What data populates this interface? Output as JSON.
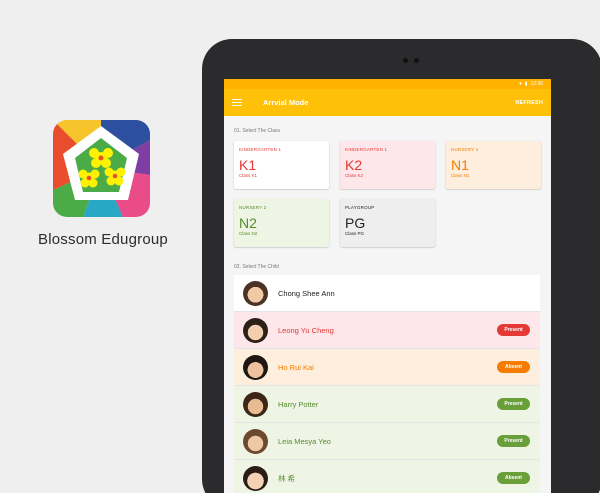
{
  "brand": {
    "name": "Blossom Edugroup",
    "logo_colors": [
      "#f7c42b",
      "#e84e2d",
      "#ea4c89",
      "#7e3ea3",
      "#2c4fa0",
      "#29a8c6",
      "#4bab47",
      "#fff200"
    ]
  },
  "status_bar": {
    "time": "12:30"
  },
  "app_bar": {
    "title": "Arrvial Mode",
    "refresh_label": "REFRESH",
    "accent": "#ffc107"
  },
  "section_class": {
    "title": "01.  Select The Class"
  },
  "classes": [
    {
      "category": "KINDERGARTEN 1",
      "code": "K1",
      "subtitle": "Class K1"
    },
    {
      "category": "KINDERGARTEN 1",
      "code": "K2",
      "subtitle": "Class K2"
    },
    {
      "category": "NURSERY 1",
      "code": "N1",
      "subtitle": "Class N1"
    },
    {
      "category": "NURSERY 2",
      "code": "N2",
      "subtitle": "Class N2"
    },
    {
      "category": "PLAYGROUP",
      "code": "PG",
      "subtitle": "Class PG"
    }
  ],
  "section_child": {
    "title": "02.  Select The Child"
  },
  "children": [
    {
      "name": "Chong Shee Ann",
      "status": ""
    },
    {
      "name": "Leong Yu Cheng",
      "status": "Present"
    },
    {
      "name": "Ho Rui Kai",
      "status": "Absent"
    },
    {
      "name": "Harry Potter",
      "status": "Present"
    },
    {
      "name": "Leia Mesya Yeo",
      "status": "Present"
    },
    {
      "name": "林 希",
      "status": "Absent"
    }
  ],
  "status_colors": {
    "red": "#e53935",
    "orange": "#f57c00",
    "green": "#689f38"
  }
}
